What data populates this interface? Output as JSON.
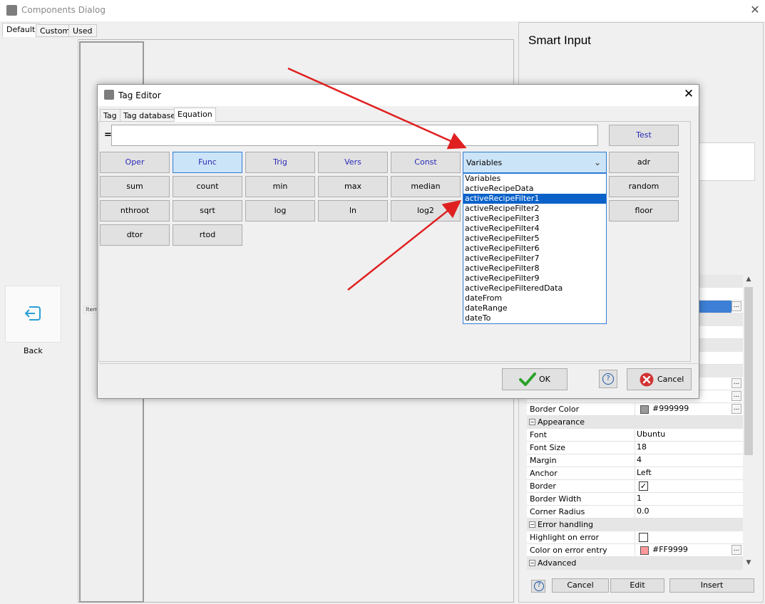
{
  "outer_window": {
    "title": "Components Dialog",
    "close_glyph": "✕",
    "tabs": [
      "Default",
      "Custom",
      "Used"
    ],
    "back_label": "Back",
    "item_label": "Item"
  },
  "side_panel": {
    "title": "Smart Input",
    "properties": {
      "border_color_label": "Border Color",
      "border_color_value": "#999999",
      "partial_value": "#FFFFFF",
      "appearance_label": "Appearance",
      "font_label": "Font",
      "font_value": "Ubuntu",
      "font_size_label": "Font Size",
      "font_size_value": "18",
      "margin_label": "Margin",
      "margin_value": "4",
      "anchor_label": "Anchor",
      "anchor_value": "Left",
      "border_label": "Border",
      "border_width_label": "Border Width",
      "border_width_value": "1",
      "corner_radius_label": "Corner Radius",
      "corner_radius_value": "0.0",
      "error_handling_label": "Error handling",
      "highlight_label": "Highlight on error",
      "color_error_label": "Color on error entry",
      "color_error_value": "#FF9999",
      "advanced_label": "Advanced"
    },
    "buttons": {
      "cancel": "Cancel",
      "edit": "Edit",
      "insert": "Insert"
    }
  },
  "tag_editor": {
    "title": "Tag Editor",
    "close_glyph": "✕",
    "tabs": [
      "Tag",
      "Tag database",
      "Equation"
    ],
    "equals": "=",
    "equation_value": "",
    "test_label": "Test",
    "category_buttons": [
      "Oper",
      "Func",
      "Trig",
      "Vers",
      "Const"
    ],
    "function_buttons": [
      "sum",
      "count",
      "min",
      "max",
      "median",
      "nthroot",
      "sqrt",
      "log",
      "ln",
      "log2",
      "dtor",
      "rtod"
    ],
    "right_buttons": [
      "adr",
      "random",
      "floor"
    ],
    "variables_select": {
      "selected": "Variables",
      "options": [
        "Variables",
        "activeRecipeData",
        "activeRecipeFilter1",
        "activeRecipeFilter2",
        "activeRecipeFilter3",
        "activeRecipeFilter4",
        "activeRecipeFilter5",
        "activeRecipeFilter6",
        "activeRecipeFilter7",
        "activeRecipeFilter8",
        "activeRecipeFilter9",
        "activeRecipeFilteredData",
        "dateFrom",
        "dateRange",
        "dateTo"
      ],
      "highlighted": "activeRecipeFilter1"
    },
    "ok_label": "OK",
    "cancel_label": "Cancel",
    "help_glyph": "?"
  },
  "colors": {
    "accent": "#0a62c9",
    "annotation_arrow": "#e02020",
    "swatch_border": "#999999",
    "swatch_error": "#FF9999"
  }
}
